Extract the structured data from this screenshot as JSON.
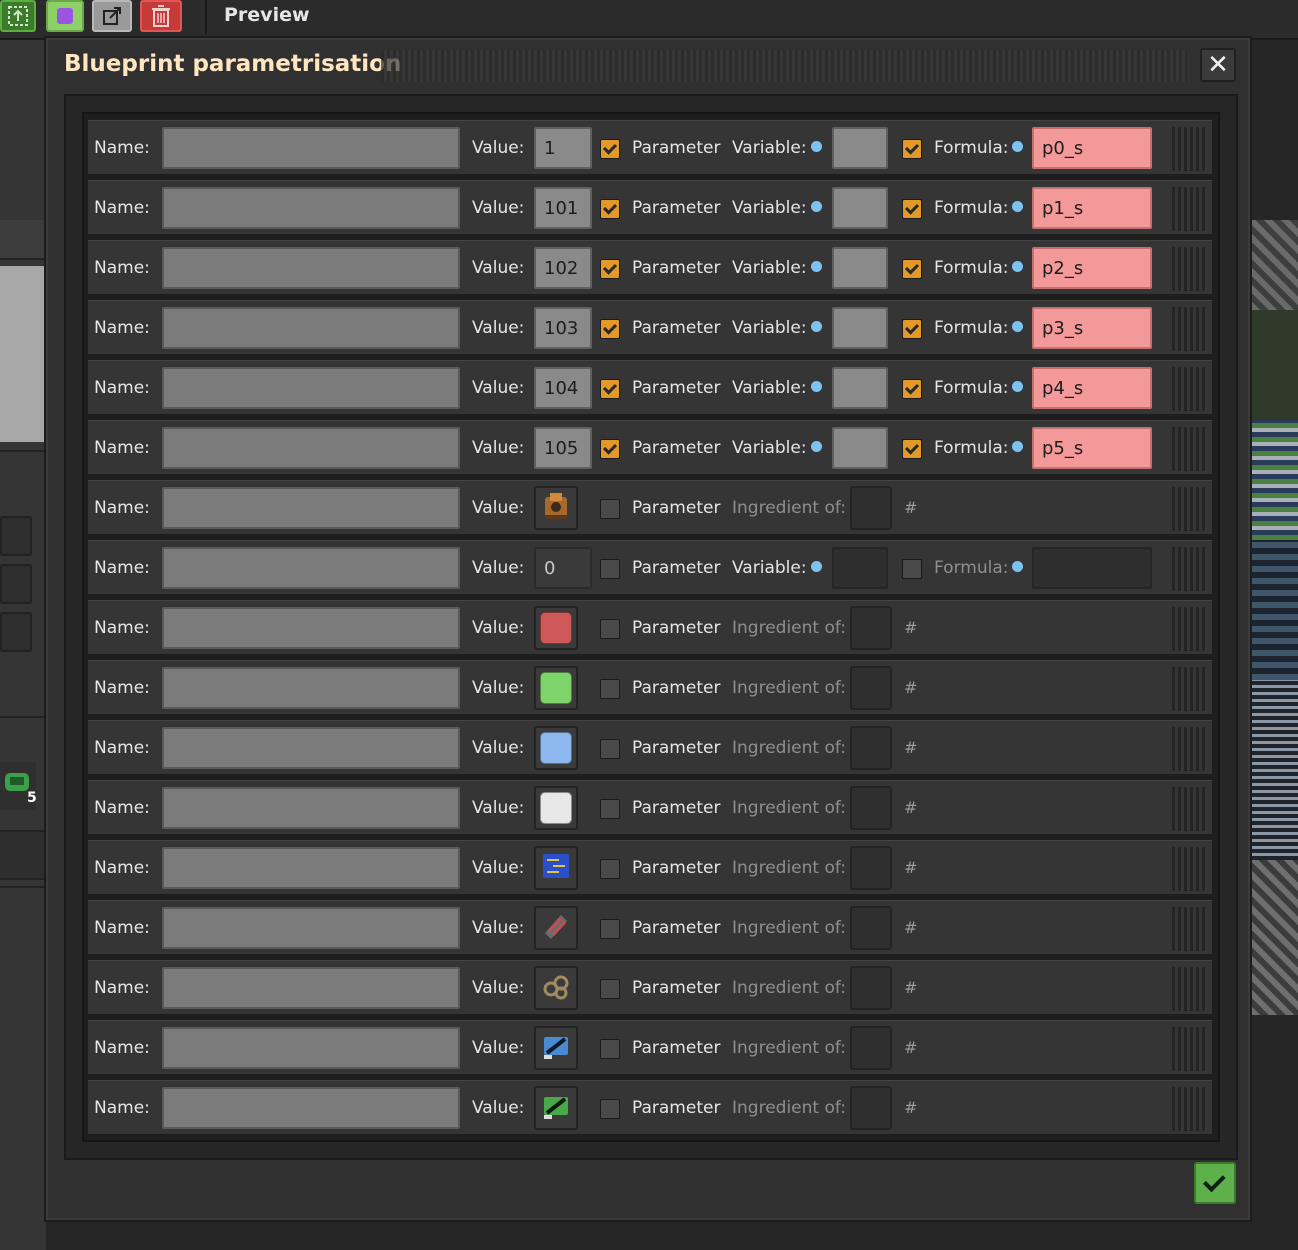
{
  "topbar": {
    "preview_label": "Preview"
  },
  "background": {
    "left_count": "5"
  },
  "dialog": {
    "title": "Blueprint parametrisation",
    "close_glyph": "✕",
    "confirm_icon": "checkmark-icon"
  },
  "labels": {
    "name": "Name:",
    "value": "Value:",
    "parameter": "Parameter",
    "variable": "Variable:",
    "formula": "Formula:",
    "ingredient": "Ingredient of:",
    "hash": "#"
  },
  "rows": [
    {
      "type": "number",
      "value": "1",
      "parameter": true,
      "formula_enabled": true,
      "formula": "p0_s"
    },
    {
      "type": "number",
      "value": "101",
      "parameter": true,
      "formula_enabled": true,
      "formula": "p1_s"
    },
    {
      "type": "number",
      "value": "102",
      "parameter": true,
      "formula_enabled": true,
      "formula": "p2_s"
    },
    {
      "type": "number",
      "value": "103",
      "parameter": true,
      "formula_enabled": true,
      "formula": "p3_s"
    },
    {
      "type": "number",
      "value": "104",
      "parameter": true,
      "formula_enabled": true,
      "formula": "p4_s"
    },
    {
      "type": "number",
      "value": "105",
      "parameter": true,
      "formula_enabled": true,
      "formula": "p5_s"
    },
    {
      "type": "item",
      "icon": "assembling-machine-icon",
      "parameter": false
    },
    {
      "type": "number",
      "value": "0",
      "parameter": false,
      "formula_enabled": false,
      "formula": ""
    },
    {
      "type": "item",
      "icon": "automation-science-pack-icon",
      "color": "#d05a5a",
      "parameter": false
    },
    {
      "type": "item",
      "icon": "logistic-science-pack-icon",
      "color": "#7ed36a",
      "parameter": false
    },
    {
      "type": "item",
      "icon": "chemical-science-pack-icon",
      "color": "#8cb8ee",
      "parameter": false
    },
    {
      "type": "item",
      "icon": "space-science-pack-icon",
      "color": "#e8e8e8",
      "parameter": false
    },
    {
      "type": "item",
      "icon": "processing-unit-icon",
      "color": "#2b4fc9",
      "parameter": false
    },
    {
      "type": "item",
      "icon": "low-density-structure-icon",
      "color": "#b55050",
      "parameter": false
    },
    {
      "type": "item",
      "icon": "rocket-fuel-icon",
      "color": "#a08a60",
      "parameter": false
    },
    {
      "type": "item",
      "icon": "rocket-part-icon",
      "color": "#4a8ad0",
      "parameter": false
    },
    {
      "type": "item",
      "icon": "satellite-icon",
      "color": "#4aa84a",
      "parameter": false
    }
  ]
}
